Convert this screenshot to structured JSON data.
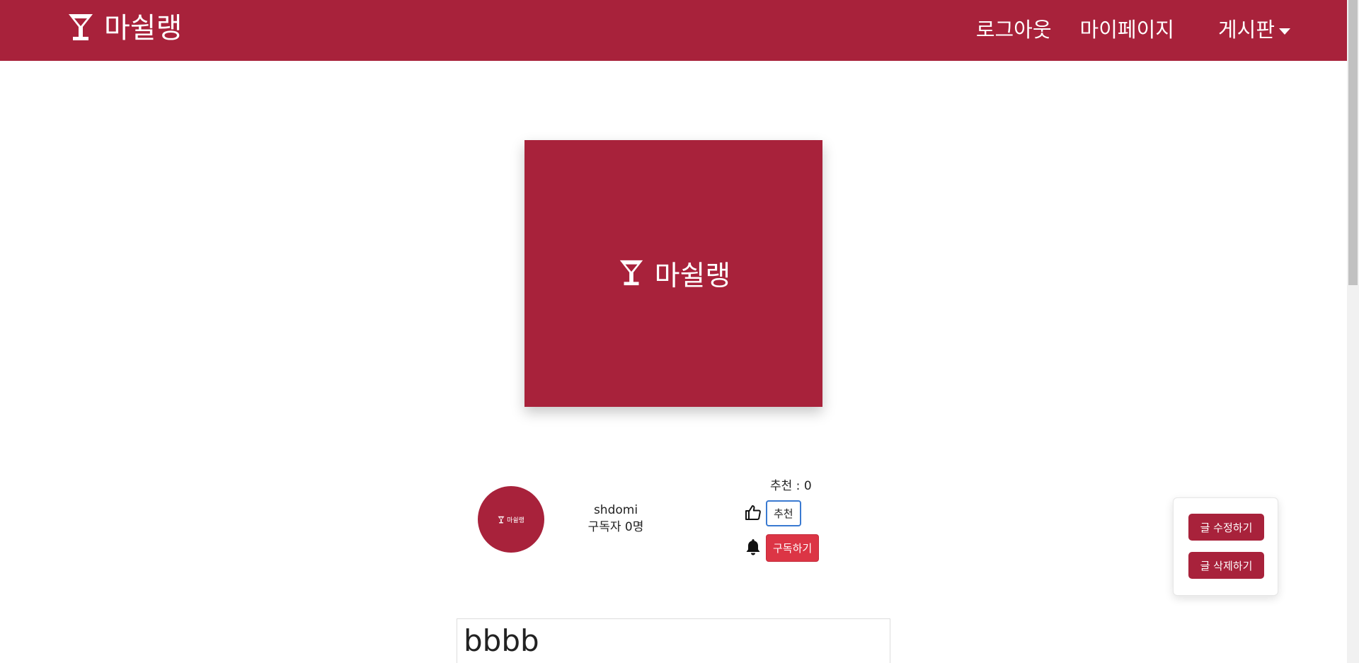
{
  "navbar": {
    "brand_name": "마쉴랭",
    "brand_icon": "cocktail-glass-icon",
    "links": {
      "logout": "로그아웃",
      "mypage": "마이페이지",
      "board": "게시판"
    },
    "background_color": "#a8223b"
  },
  "hero": {
    "brand_name": "마쉴랭",
    "icon": "cocktail-glass-icon"
  },
  "author": {
    "avatar_text": "마쉴랭",
    "username": "shdomi",
    "subscribers": "구독자 0명"
  },
  "recommend": {
    "count_text": "추천 : 0",
    "button_label": "추천",
    "icon": "thumbs-up-icon"
  },
  "subscribe": {
    "button_label": "구독하기",
    "icon": "bell-icon",
    "button_color": "#dc3545"
  },
  "actions": {
    "edit_label": "글 수정하기",
    "delete_label": "글 삭제하기"
  },
  "post": {
    "title": "bbbb"
  }
}
